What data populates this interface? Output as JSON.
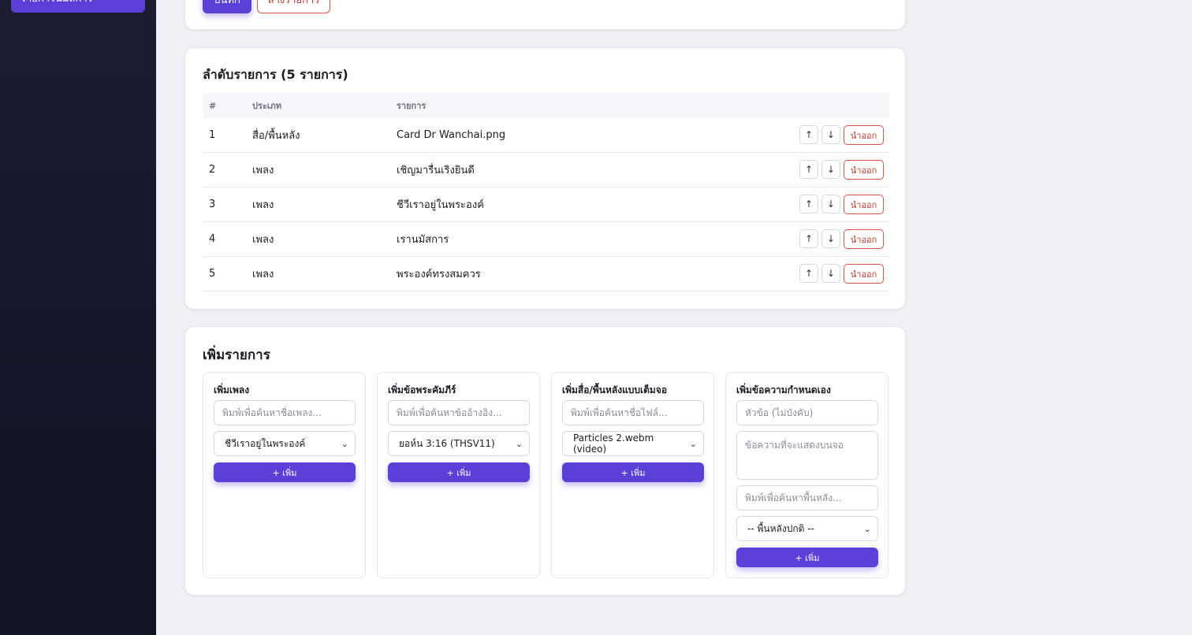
{
  "sidebar": {
    "active_item_label": "รายการนมัสการ"
  },
  "top_card": {
    "save_label": "บันทึก",
    "clear_label": "ล้างรายการ"
  },
  "queue": {
    "title": "ลำดับรายการ (5 รายการ)",
    "columns": [
      "#",
      "ประเภท",
      "รายการ"
    ],
    "up_label": "↑",
    "down_label": "↓",
    "remove_label": "นำออก",
    "rows": [
      {
        "num": "1",
        "type": "สื่อ/พื้นหลัง",
        "item": "Card Dr Wanchai.png"
      },
      {
        "num": "2",
        "type": "เพลง",
        "item": "เชิญมารื่นเริงยินดี"
      },
      {
        "num": "3",
        "type": "เพลง",
        "item": "ชีวีเราอยู่ในพระองค์"
      },
      {
        "num": "4",
        "type": "เพลง",
        "item": "เรานมัสการ"
      },
      {
        "num": "5",
        "type": "เพลง",
        "item": "พระองค์ทรงสมควร"
      }
    ]
  },
  "add": {
    "title": "เพิ่มรายการ",
    "add_label": "+ เพิ่ม",
    "song": {
      "title": "เพิ่มเพลง",
      "search_placeholder": "พิมพ์เพื่อค้นหาชื่อเพลง...",
      "selected": "ชีวีเราอยู่ในพระองค์"
    },
    "scripture": {
      "title": "เพิ่มข้อพระคัมภีร์",
      "search_placeholder": "พิมพ์เพื่อค้นหาข้ออ้างอิง...",
      "selected": "ยอห์น 3:16 (THSV11)"
    },
    "media": {
      "title": "เพิ่มสื่อ/พื้นหลังแบบเต็มจอ",
      "search_placeholder": "พิมพ์เพื่อค้นหาชื่อไฟล์...",
      "selected": "Particles 2.webm (video)"
    },
    "custom": {
      "title": "เพิ่มข้อความกำหนดเอง",
      "heading_placeholder": "หัวข้อ (ไม่บังคับ)",
      "text_placeholder": "ข้อความที่จะแสดงบนจอ",
      "bg_search_placeholder": "พิมพ์เพื่อค้นหาพื้นหลัง...",
      "selected": "-- พื้นหลังปกติ --"
    }
  },
  "icons": {
    "dropdown": "chevron-down-icon"
  },
  "colors": {
    "accent": "#5b3fd6",
    "danger": "#d9534f",
    "sidebar": "#16172c"
  }
}
